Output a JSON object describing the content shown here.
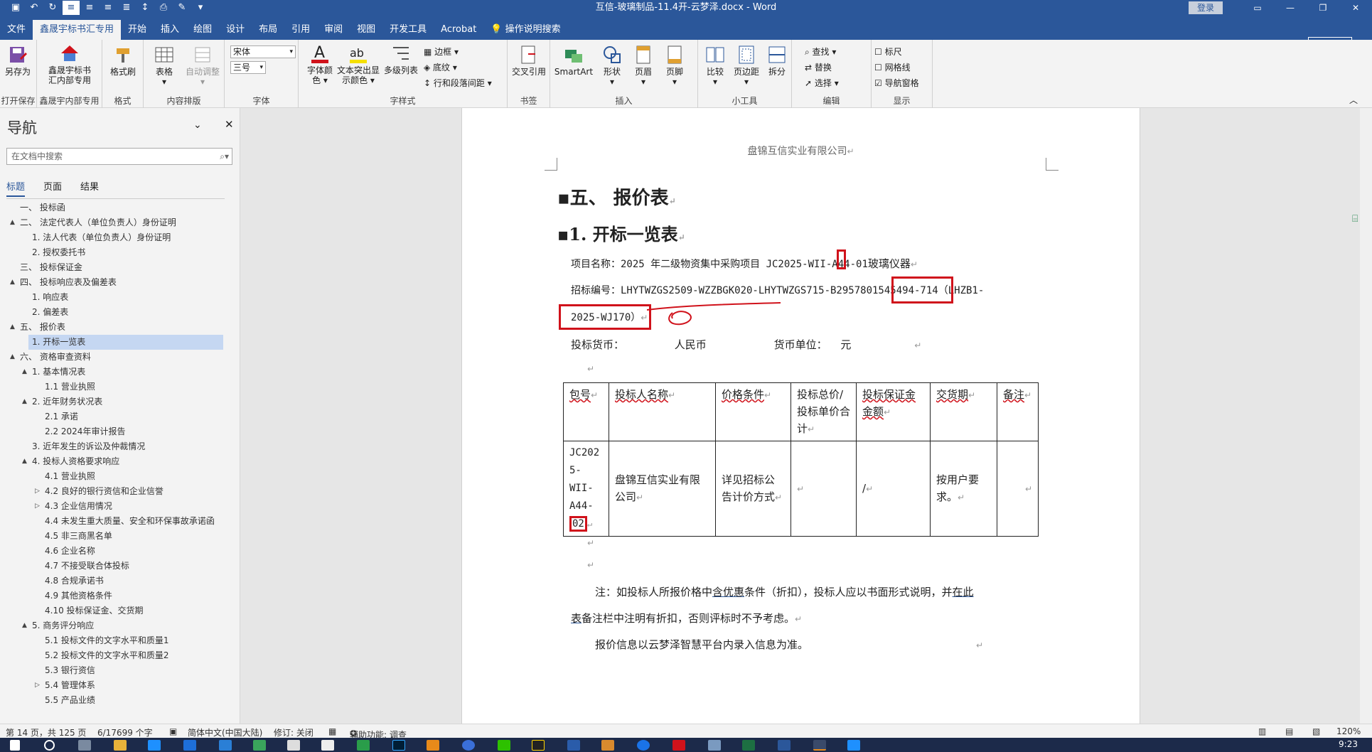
{
  "titlebar": {
    "document_title": "互信-玻璃制品-11.4开-云梦泽.docx - Word",
    "login_label": "登录"
  },
  "tabs": [
    {
      "label": "文件"
    },
    {
      "label": "鑫晟宇标书汇专用"
    },
    {
      "label": "开始"
    },
    {
      "label": "插入"
    },
    {
      "label": "绘图"
    },
    {
      "label": "设计"
    },
    {
      "label": "布局"
    },
    {
      "label": "引用"
    },
    {
      "label": "审阅"
    },
    {
      "label": "视图"
    },
    {
      "label": "开发工具"
    },
    {
      "label": "Acrobat"
    },
    {
      "label": "操作说明搜索"
    }
  ],
  "share_label": "共享",
  "ribbon": {
    "save_as": "另存为",
    "open_save": "打开保存",
    "xsy_label_1": "鑫晟宇标书",
    "xsy_label_2": "汇内部专用",
    "xsy_group": "鑫晟宇内部专用",
    "format_painter": "格式刷",
    "format_group": "格式",
    "table": "表格",
    "auto_adjust": "自动调整",
    "content_group": "内容排版",
    "font_name": "宋体",
    "font_size": "三号",
    "font_group": "字体",
    "font_color_1": "字体颜",
    "font_color_2": "色",
    "highlight_1": "文本突出显",
    "highlight_2": "示颜色",
    "multilevel": "多级列表",
    "border": "边框",
    "shading": "底纹",
    "line_spacing": "行和段落间距",
    "style_group": "字样式",
    "cross_ref": "交叉引用",
    "bookmark_group": "书签",
    "smartart": "SmartArt",
    "shape": "形状",
    "header": "页眉",
    "footer": "页脚",
    "insert_group": "插入",
    "compare": "比较",
    "page_margin": "页边距",
    "split": "拆分",
    "tools_group": "小工具",
    "find": "查找",
    "replace": "替换",
    "select": "选择",
    "edit_group": "编辑",
    "ruler": "标尺",
    "gridlines": "网格线",
    "nav_pane": "导航窗格",
    "display_group": "显示"
  },
  "nav": {
    "title": "导航",
    "search_placeholder": "在文档中搜索",
    "tabs": [
      {
        "label": "标题"
      },
      {
        "label": "页面"
      },
      {
        "label": "结果"
      }
    ],
    "items": [
      {
        "label": "一、 投标函"
      },
      {
        "label": "二、 法定代表人（单位负责人）身份证明"
      },
      {
        "label": "1. 法人代表（单位负责人）身份证明"
      },
      {
        "label": "2. 授权委托书"
      },
      {
        "label": "三、 投标保证金"
      },
      {
        "label": "四、 投标响应表及偏差表"
      },
      {
        "label": "1. 响应表"
      },
      {
        "label": "2. 偏差表"
      },
      {
        "label": "五、 报价表"
      },
      {
        "label": "1. 开标一览表"
      },
      {
        "label": "六、 资格审查资料"
      },
      {
        "label": "1. 基本情况表"
      },
      {
        "label": "1.1 营业执照"
      },
      {
        "label": "2. 近年财务状况表"
      },
      {
        "label": "2.1 承诺"
      },
      {
        "label": "2.2 2024年审计报告"
      },
      {
        "label": "3. 近年发生的诉讼及仲裁情况"
      },
      {
        "label": "4. 投标人资格要求响应"
      },
      {
        "label": "4.1 营业执照"
      },
      {
        "label": "4.2 良好的银行资信和企业信誉"
      },
      {
        "label": "4.3 企业信用情况"
      },
      {
        "label": "4.4 未发生重大质量、安全和环保事故承诺函"
      },
      {
        "label": "4.5 非三商黑名单"
      },
      {
        "label": "4.6 企业名称"
      },
      {
        "label": "4.7 不接受联合体投标"
      },
      {
        "label": "4.8 合规承诺书"
      },
      {
        "label": "4.9 其他资格条件"
      },
      {
        "label": "4.10 投标保证金、交货期"
      },
      {
        "label": "5. 商务评分响应"
      },
      {
        "label": "5.1 投标文件的文字水平和质量1"
      },
      {
        "label": "5.2 投标文件的文字水平和质量2"
      },
      {
        "label": "5.3 银行资信"
      },
      {
        "label": "5.4 管理体系"
      },
      {
        "label": "5.5 产品业绩"
      }
    ]
  },
  "document": {
    "header": "盘锦互信实业有限公司",
    "h1": "五、 报价表",
    "h2": "1. 开标一览表",
    "project_label": "项目名称：2025 年二级物资集中采购项目 JC2025-WII-A44-",
    "project_hl": "01",
    "project_rest": "玻璃仪器",
    "bid_no_1": "招标编号：LHYTWZGS2509-WZZBGK020-LHYTWZGS715-B2957801545494-714",
    "bid_no_hl1": "（LHZB1-",
    "bid_no_2": "2025-WJ170）",
    "currency_label": "投标货币：",
    "currency_value": "人民币",
    "unit_label": "货币单位：",
    "unit_value": "元",
    "table_headers": [
      "包号",
      "投标人名称",
      "价格条件",
      "投标总价/投标单价合计",
      "投标保证金金额",
      "交货期",
      "备注"
    ],
    "row_pkg_1": "JC202",
    "row_pkg_2": "5-",
    "row_pkg_3": "WII-",
    "row_pkg_4": "A44-",
    "row_pkg_hl": "02",
    "row_bidder": "盘锦互信实业有限公司",
    "row_price": "详见招标公告计价方式",
    "row_total": "",
    "row_deposit": "/",
    "row_delivery": "按用户要求。",
    "row_remark": "",
    "note_1a": "注：如投标人所报价格中",
    "note_1b": "含优惠",
    "note_1c": "条件（折扣），投标人应以书面形式说明，并",
    "note_1d": "在此",
    "note_2a": "表",
    "note_2b": "备注栏中注明有折扣，否则评标时不予考虑。",
    "note_3": "报价信息以云梦泽智慧平台内录入信息为准。"
  },
  "status": {
    "page": "第 14 页，共 125 页",
    "words": "6/17699 个字",
    "lang": "简体中文(中国大陆)",
    "track": "修订: 关闭",
    "accessibility": "辅助功能: 调查",
    "zoom": "120%"
  },
  "taskbar": {
    "time": "9:23"
  }
}
